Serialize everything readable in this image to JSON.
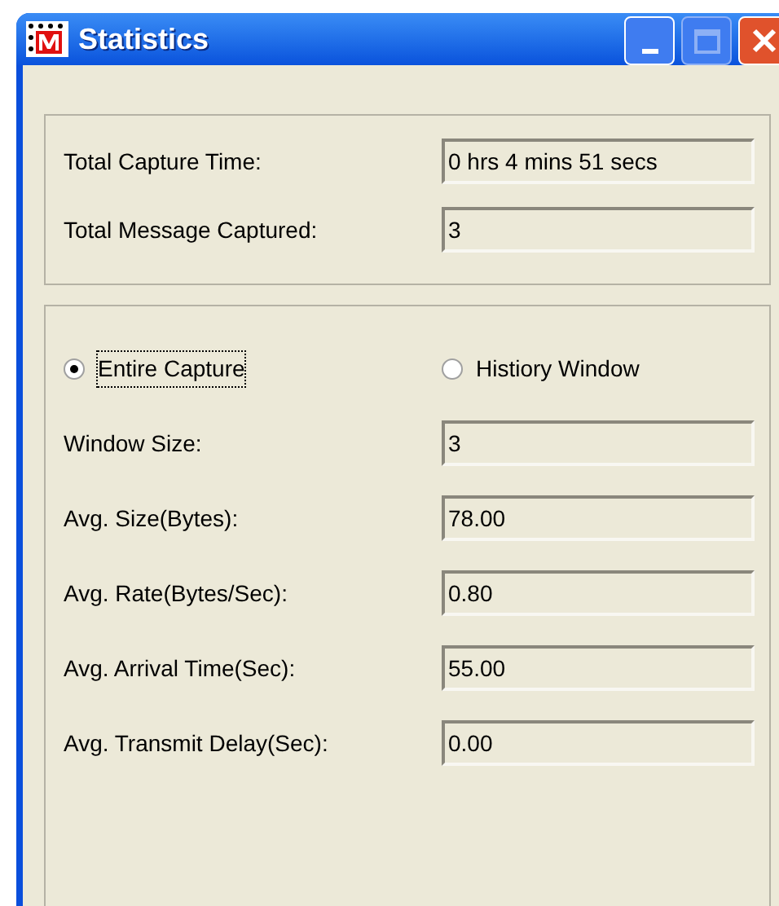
{
  "window": {
    "title": "Statistics"
  },
  "totals": [
    {
      "label": "Total Capture Time:",
      "value": "0 hrs 4 mins 51 secs"
    },
    {
      "label": "Total Message Captured:",
      "value": "3"
    }
  ],
  "scope": [
    {
      "label": "Entire Capture",
      "selected": true
    },
    {
      "label": "Histiory Window",
      "selected": false
    }
  ],
  "metrics": [
    {
      "label": "Window Size:",
      "value": "3"
    },
    {
      "label": "Avg. Size(Bytes):",
      "value": "78.00"
    },
    {
      "label": "Avg. Rate(Bytes/Sec):",
      "value": "0.80"
    },
    {
      "label": "Avg. Arrival Time(Sec):",
      "value": "55.00"
    },
    {
      "label": "Avg. Transmit Delay(Sec):",
      "value": "0.00"
    }
  ]
}
